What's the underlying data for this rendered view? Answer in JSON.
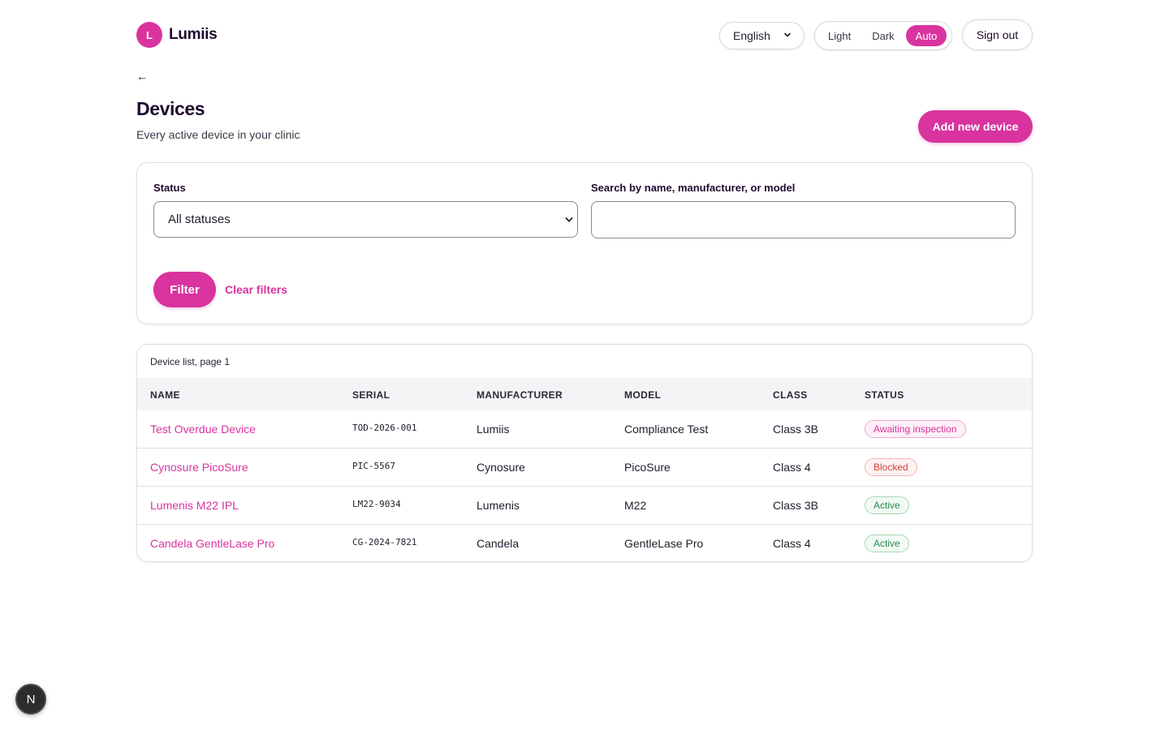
{
  "brand": {
    "logo_letter": "L",
    "name": "Lumiis"
  },
  "header": {
    "language": "English",
    "theme_options": [
      "Light",
      "Dark",
      "Auto"
    ],
    "theme_selected": "Auto",
    "sign_out": "Sign out"
  },
  "nav": {
    "back": "←"
  },
  "page": {
    "title": "Devices",
    "subtitle": "Every active device in your clinic",
    "add_button": "Add new device"
  },
  "filters": {
    "status_label": "Status",
    "status_value": "All statuses",
    "search_label": "Search by name, manufacturer, or model",
    "search_value": "",
    "filter_button": "Filter",
    "clear_link": "Clear filters"
  },
  "table": {
    "caption": "Device list, page 1",
    "columns": [
      "NAME",
      "SERIAL",
      "MANUFACTURER",
      "MODEL",
      "CLASS",
      "STATUS"
    ],
    "rows": [
      {
        "name": "Test Overdue Device",
        "serial": "TOD-2026-001",
        "manufacturer": "Lumiis",
        "model": "Compliance Test",
        "class": "Class 3B",
        "status": "Awaiting inspection"
      },
      {
        "name": "Cynosure PicoSure",
        "serial": "PIC-5567",
        "manufacturer": "Cynosure",
        "model": "PicoSure",
        "class": "Class 4",
        "status": "Blocked"
      },
      {
        "name": "Lumenis M22 IPL",
        "serial": "LM22-9034",
        "manufacturer": "Lumenis",
        "model": "M22",
        "class": "Class 3B",
        "status": "Active"
      },
      {
        "name": "Candela GentleLase Pro",
        "serial": "CG-2024-7821",
        "manufacturer": "Candela",
        "model": "GentleLase Pro",
        "class": "Class 4",
        "status": "Active"
      }
    ]
  },
  "dev_badge": {
    "letter": "N"
  },
  "colors": {
    "accent": "#d9339f",
    "heading": "#1e0b2e",
    "active": "#2a8a4a",
    "blocked": "#d6403c"
  }
}
